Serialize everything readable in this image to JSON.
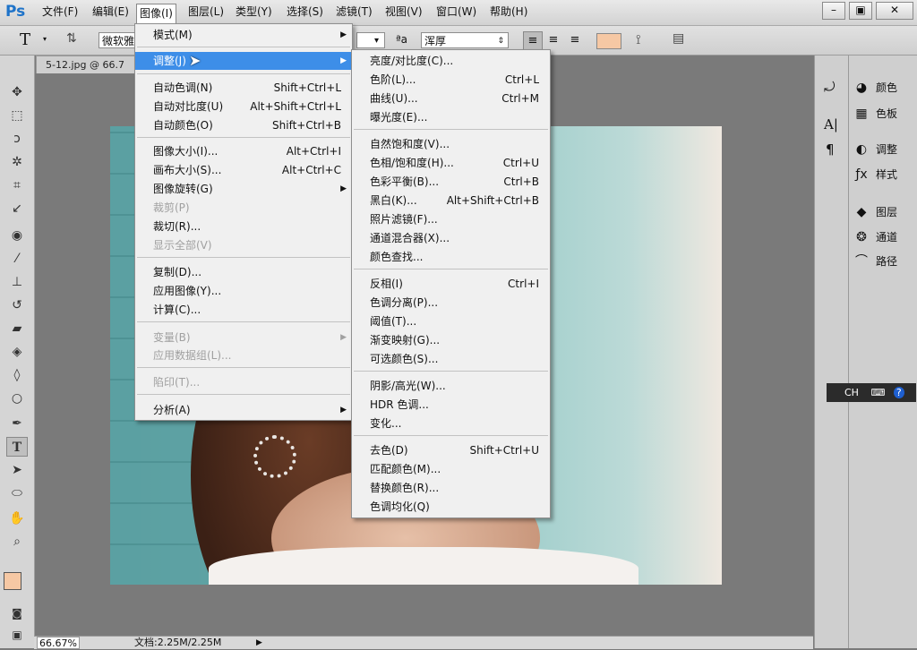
{
  "menubar": {
    "logo": "Ps",
    "items": [
      "文件(F)",
      "编辑(E)",
      "图像(I)",
      "图层(L)",
      "类型(Y)",
      "选择(S)",
      "滤镜(T)",
      "视图(V)",
      "窗口(W)",
      "帮助(H)"
    ],
    "window_buttons": [
      "–",
      "▣",
      "✕"
    ]
  },
  "options": {
    "font_family": "微软雅",
    "font_style_suffix": "▾",
    "antialias_label": "ªa",
    "antialias_value": "浑厚",
    "text_color": "#f6c8a4"
  },
  "document_tab": "5-12.jpg @ 66.7",
  "status": {
    "zoom": "66.67%",
    "doc_size": "文档:2.25M/2.25M"
  },
  "right_panel": {
    "items": [
      {
        "label": "颜色",
        "icon": "palette-icon"
      },
      {
        "label": "色板",
        "icon": "swatches-icon"
      },
      {
        "label": "调整",
        "icon": "adjustments-icon"
      },
      {
        "label": "样式",
        "icon": "styles-icon"
      },
      {
        "label": "图层",
        "icon": "layers-icon"
      },
      {
        "label": "通道",
        "icon": "channels-icon"
      },
      {
        "label": "路径",
        "icon": "paths-icon"
      }
    ]
  },
  "ime_bar": {
    "label": "CH"
  },
  "image_menu": {
    "items": [
      {
        "label": "模式(M)",
        "submenu": true
      },
      {
        "label": "调整(J)",
        "submenu": true,
        "highlight": true
      },
      {
        "label": "自动色调(N)",
        "shortcut": "Shift+Ctrl+L"
      },
      {
        "label": "自动对比度(U)",
        "shortcut": "Alt+Shift+Ctrl+L"
      },
      {
        "label": "自动颜色(O)",
        "shortcut": "Shift+Ctrl+B"
      },
      {
        "label": "图像大小(I)...",
        "shortcut": "Alt+Ctrl+I"
      },
      {
        "label": "画布大小(S)...",
        "shortcut": "Alt+Ctrl+C"
      },
      {
        "label": "图像旋转(G)",
        "submenu": true
      },
      {
        "label": "裁剪(P)",
        "disabled": true
      },
      {
        "label": "裁切(R)..."
      },
      {
        "label": "显示全部(V)",
        "disabled": true
      },
      {
        "label": "复制(D)..."
      },
      {
        "label": "应用图像(Y)..."
      },
      {
        "label": "计算(C)..."
      },
      {
        "label": "变量(B)",
        "submenu": true,
        "disabled": true
      },
      {
        "label": "应用数据组(L)...",
        "disabled": true
      },
      {
        "label": "陷印(T)...",
        "disabled": true
      },
      {
        "label": "分析(A)",
        "submenu": true
      }
    ]
  },
  "adjust_menu": {
    "items": [
      {
        "label": "亮度/对比度(C)..."
      },
      {
        "label": "色阶(L)...",
        "shortcut": "Ctrl+L"
      },
      {
        "label": "曲线(U)...",
        "shortcut": "Ctrl+M"
      },
      {
        "label": "曝光度(E)..."
      },
      {
        "label": "自然饱和度(V)..."
      },
      {
        "label": "色相/饱和度(H)...",
        "shortcut": "Ctrl+U"
      },
      {
        "label": "色彩平衡(B)...",
        "shortcut": "Ctrl+B"
      },
      {
        "label": "黑白(K)...",
        "shortcut": "Alt+Shift+Ctrl+B"
      },
      {
        "label": "照片滤镜(F)..."
      },
      {
        "label": "通道混合器(X)..."
      },
      {
        "label": "颜色查找..."
      },
      {
        "label": "反相(I)",
        "shortcut": "Ctrl+I"
      },
      {
        "label": "色调分离(P)..."
      },
      {
        "label": "阈值(T)..."
      },
      {
        "label": "渐变映射(G)..."
      },
      {
        "label": "可选颜色(S)..."
      },
      {
        "label": "阴影/高光(W)..."
      },
      {
        "label": "HDR 色调..."
      },
      {
        "label": "变化..."
      },
      {
        "label": "去色(D)",
        "shortcut": "Shift+Ctrl+U"
      },
      {
        "label": "匹配颜色(M)..."
      },
      {
        "label": "替换颜色(R)..."
      },
      {
        "label": "色调均化(Q)"
      }
    ]
  }
}
